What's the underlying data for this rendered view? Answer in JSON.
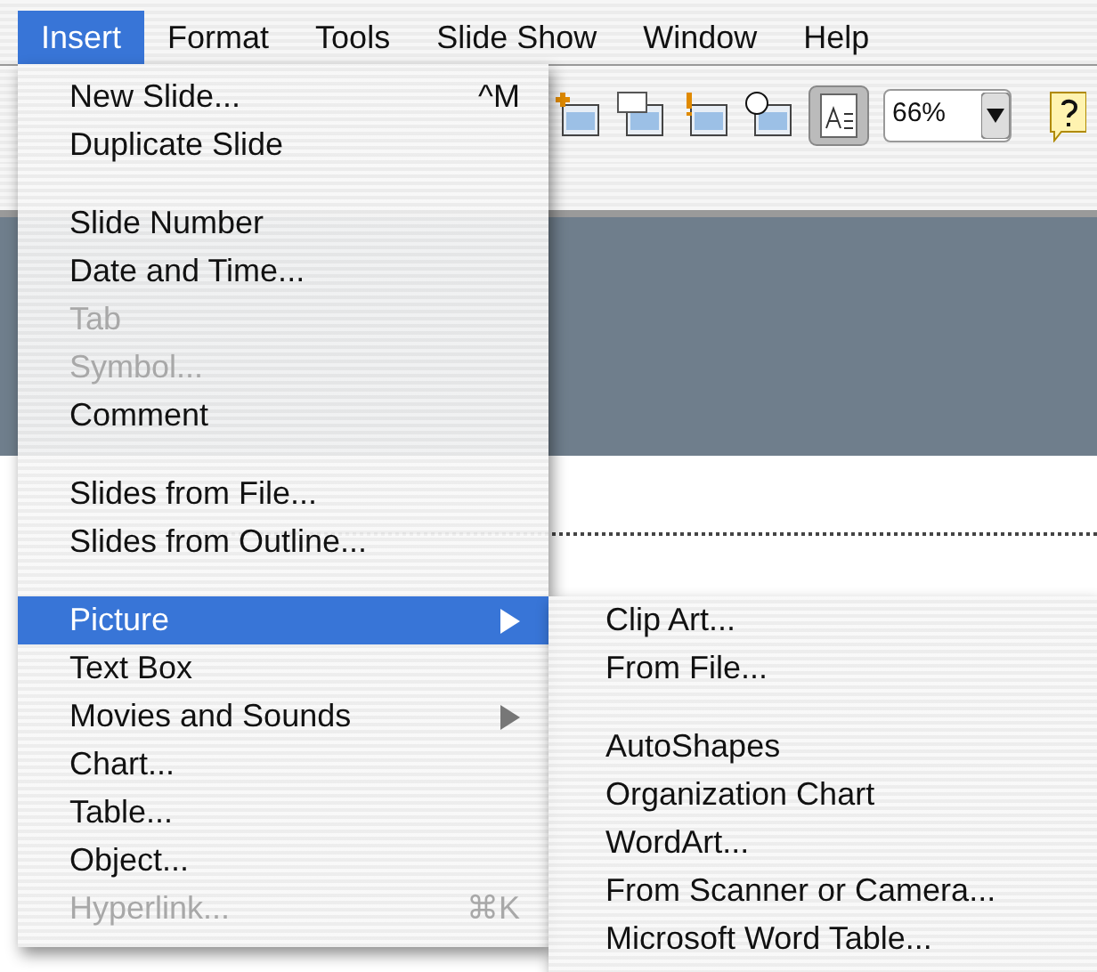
{
  "menubar": [
    {
      "label": "Insert",
      "selected": true
    },
    {
      "label": "Format",
      "selected": false
    },
    {
      "label": "Tools",
      "selected": false
    },
    {
      "label": "Slide Show",
      "selected": false
    },
    {
      "label": "Window",
      "selected": false
    },
    {
      "label": "Help",
      "selected": false
    }
  ],
  "toolbar": {
    "zoom": "66%"
  },
  "insert_menu": [
    {
      "kind": "item",
      "label": "New Slide...",
      "shortcut": "^M",
      "disabled": false,
      "selected": false,
      "submenu": false
    },
    {
      "kind": "item",
      "label": "Duplicate Slide",
      "disabled": false,
      "selected": false,
      "submenu": false
    },
    {
      "kind": "separator"
    },
    {
      "kind": "item",
      "label": "Slide Number",
      "disabled": false,
      "selected": false,
      "submenu": false
    },
    {
      "kind": "item",
      "label": "Date and Time...",
      "disabled": false,
      "selected": false,
      "submenu": false
    },
    {
      "kind": "item",
      "label": "Tab",
      "disabled": true,
      "selected": false,
      "submenu": false
    },
    {
      "kind": "item",
      "label": "Symbol...",
      "disabled": true,
      "selected": false,
      "submenu": false
    },
    {
      "kind": "item",
      "label": "Comment",
      "disabled": false,
      "selected": false,
      "submenu": false
    },
    {
      "kind": "separator"
    },
    {
      "kind": "item",
      "label": "Slides from File...",
      "disabled": false,
      "selected": false,
      "submenu": false
    },
    {
      "kind": "item",
      "label": "Slides from Outline...",
      "disabled": false,
      "selected": false,
      "submenu": false
    },
    {
      "kind": "separator"
    },
    {
      "kind": "item",
      "label": "Picture",
      "disabled": false,
      "selected": true,
      "submenu": true
    },
    {
      "kind": "item",
      "label": "Text Box",
      "disabled": false,
      "selected": false,
      "submenu": false
    },
    {
      "kind": "item",
      "label": "Movies and Sounds",
      "disabled": false,
      "selected": false,
      "submenu": true
    },
    {
      "kind": "item",
      "label": "Chart...",
      "disabled": false,
      "selected": false,
      "submenu": false
    },
    {
      "kind": "item",
      "label": "Table...",
      "disabled": false,
      "selected": false,
      "submenu": false
    },
    {
      "kind": "item",
      "label": "Object...",
      "disabled": false,
      "selected": false,
      "submenu": false
    },
    {
      "kind": "item",
      "label": "Hyperlink...",
      "shortcut": "⌘K",
      "disabled": true,
      "selected": false,
      "submenu": false
    }
  ],
  "picture_submenu": [
    {
      "kind": "item",
      "label": "Clip Art..."
    },
    {
      "kind": "item",
      "label": "From File..."
    },
    {
      "kind": "separator"
    },
    {
      "kind": "item",
      "label": "AutoShapes"
    },
    {
      "kind": "item",
      "label": "Organization Chart"
    },
    {
      "kind": "item",
      "label": "WordArt..."
    },
    {
      "kind": "item",
      "label": "From Scanner or Camera..."
    },
    {
      "kind": "item",
      "label": "Microsoft Word Table..."
    }
  ]
}
